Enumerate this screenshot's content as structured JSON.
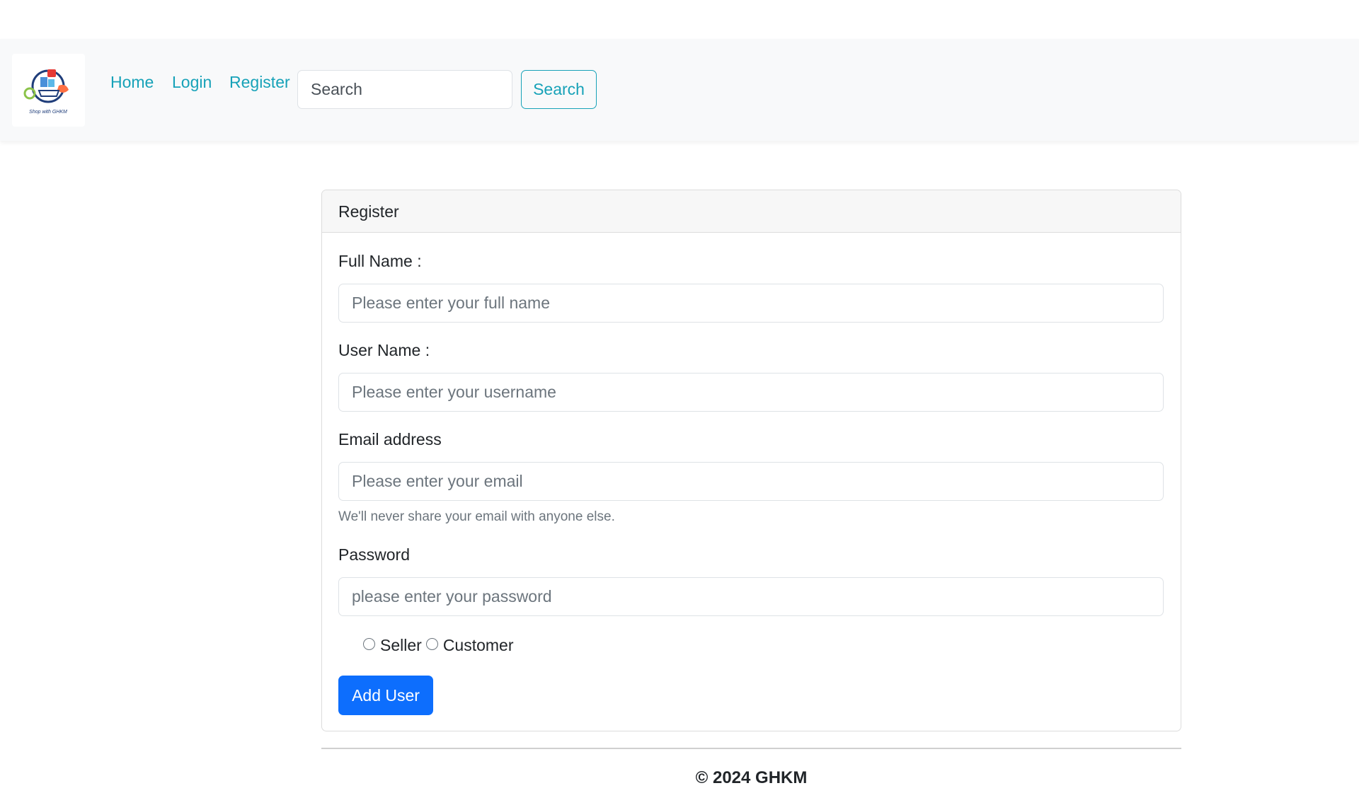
{
  "navbar": {
    "logo_text": "Shop with GHKM",
    "links": [
      {
        "label": "Home"
      },
      {
        "label": "Login"
      },
      {
        "label": "Register"
      }
    ],
    "search_placeholder": "Search",
    "search_button": "Search",
    "accent_color": "#17a2b8"
  },
  "card": {
    "title": "Register",
    "full_name_label": "Full Name :",
    "full_name_placeholder": "Please enter your full name",
    "username_label": "User Name :",
    "username_placeholder": "Please enter your username",
    "email_label": "Email address",
    "email_placeholder": "Please enter your email",
    "email_help": "We'll never share your email with anyone else.",
    "password_label": "Password",
    "password_placeholder": "please enter your password",
    "role_options": [
      {
        "label": "Seller"
      },
      {
        "label": "Customer"
      }
    ],
    "submit_label": "Add User",
    "submit_color": "#0d6efd"
  },
  "footer": {
    "text": "© 2024 GHKM"
  }
}
